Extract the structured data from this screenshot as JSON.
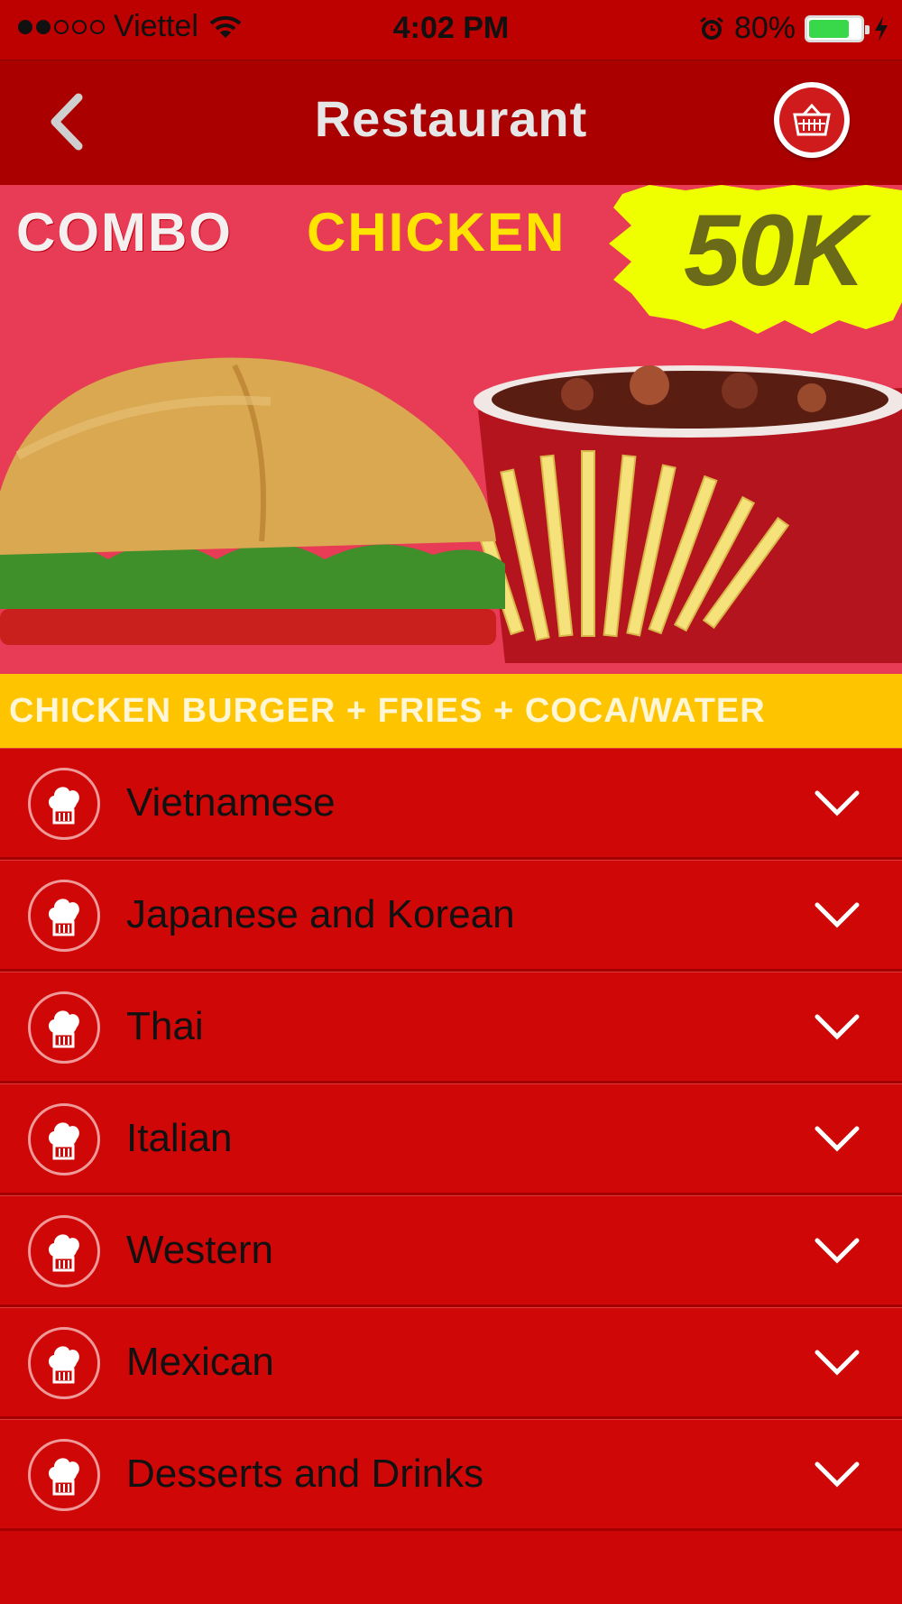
{
  "status_bar": {
    "carrier": "Viettel",
    "time": "4:02 PM",
    "battery_percent": "80%",
    "battery_level": 0.8,
    "signal_strength": 2,
    "signal_max": 5
  },
  "nav": {
    "title": "Restaurant",
    "back_icon": "chevron-left-icon",
    "cart_icon": "basket-icon"
  },
  "banner": {
    "word1": "COMBO",
    "word2": "CHICKEN",
    "price": "50K",
    "strip": "CHICKEN BURGER + FRIES + COCA/WATER"
  },
  "menu": {
    "items": [
      {
        "label": "Vietnamese"
      },
      {
        "label": "Japanese and Korean"
      },
      {
        "label": "Thai"
      },
      {
        "label": "Italian"
      },
      {
        "label": "Western"
      },
      {
        "label": "Mexican"
      },
      {
        "label": "Desserts and Drinks"
      }
    ],
    "item_icon": "chef-hat-icon",
    "expand_icon": "chevron-down-icon"
  },
  "colors": {
    "nav_bar": "#aa0000",
    "menu_background": "#d00707",
    "banner_background": "#e83b55",
    "price_burst": "#f0ff00",
    "strip": "#ffc400"
  }
}
